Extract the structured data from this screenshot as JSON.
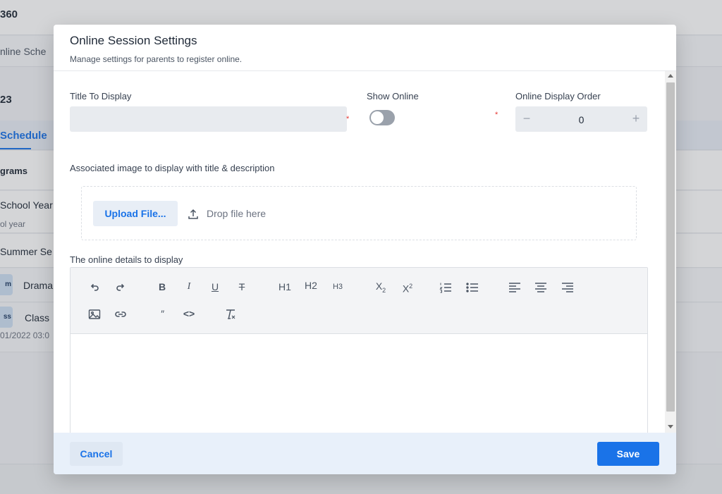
{
  "background": {
    "brand": "360",
    "sub_nav": "nline Sche",
    "year": "23",
    "tab": "Schedule",
    "rows": {
      "programs": "grams",
      "school_year": "School Year",
      "school_year_sub": "ol year",
      "summer": "Summer Se",
      "drama_badge": "m",
      "drama": "Drama",
      "class_badge": "ss",
      "class": "Class",
      "date": "01/2022 03:0"
    }
  },
  "modal": {
    "title": "Online Session Settings",
    "subtitle": "Manage settings for parents to register online.",
    "fields": {
      "title_label": "Title To Display",
      "title_value": "",
      "required_mark": "*",
      "show_online_label": "Show Online",
      "show_online_on": false,
      "order_label": "Online Display Order",
      "order_minus": "−",
      "order_value": "0",
      "order_plus": "+",
      "image_label": "Associated image to display with title & description",
      "upload_label": "Upload File...",
      "drop_text": "Drop file here",
      "details_label": "The online details to display"
    },
    "toolbar": {
      "bold": "B",
      "italic": "I",
      "underline": "U",
      "strike": "T",
      "h1": "H1",
      "h2": "H2",
      "h3": "H3",
      "subscript": "X",
      "subscript_mark": "2",
      "superscript": "X",
      "superscript_mark": "2",
      "blockquote": "″",
      "code": "<>"
    },
    "footer": {
      "cancel": "Cancel",
      "save": "Save"
    }
  },
  "colors": {
    "primary": "#1a73e8",
    "required": "#e53935",
    "footer_bg": "#e8f0fa"
  }
}
